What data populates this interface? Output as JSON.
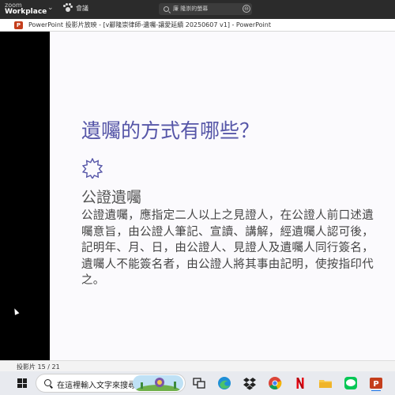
{
  "zoom": {
    "app_name_top": "zoom",
    "app_name": "Workplace",
    "meeting_label": "會議",
    "search_text": "廉 隆崇的螢幕"
  },
  "powerpoint": {
    "window_title": "PowerPoint 投影片放映 - [v酈隆崇律師-遺囑-讓愛延續 20250607 v1] - PowerPoint",
    "icon_letter": "P"
  },
  "slide": {
    "title": "遺囑的方式有哪些？",
    "subheading": "公證遺囑",
    "body": "公證遺囑，應指定二人以上之見證人，在公證人前口述遺囑意旨，由公證人筆記、宣讀、講解，經遺囑人認可後，記明年、月、日，由公證人、見證人及遺囑人同行簽名，遺囑人不能簽名者，由公證人將其事由記明，使按指印代之。"
  },
  "status_bar": {
    "slide_counter": "投影片 15 / 21"
  },
  "taskbar": {
    "search_placeholder": "在這裡輸入文字來搜尋"
  },
  "colors": {
    "title_color": "#5656a8",
    "body_color": "#444444",
    "ppt_brand": "#c43e1c"
  }
}
